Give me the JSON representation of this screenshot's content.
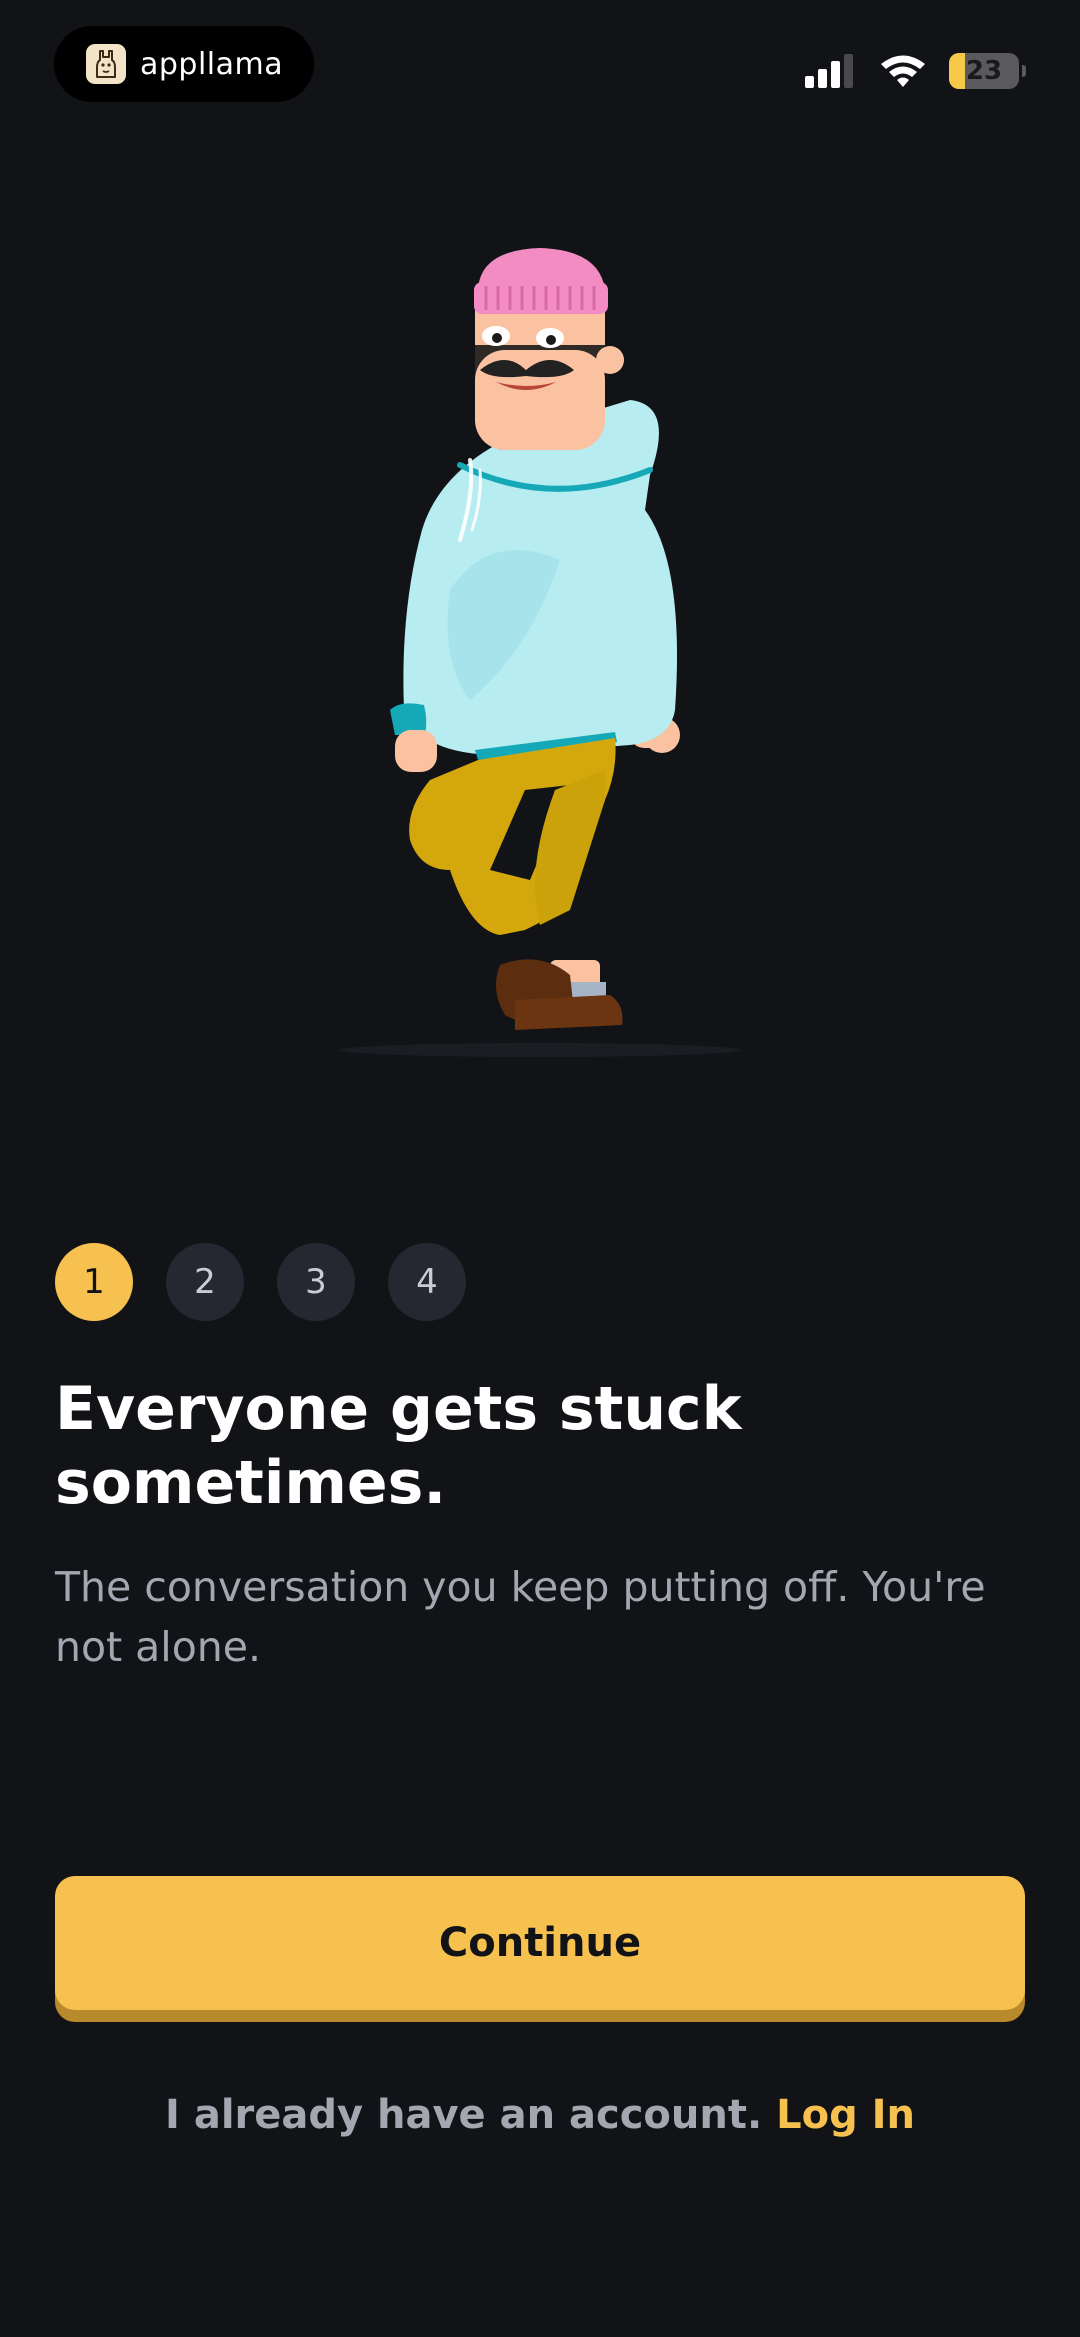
{
  "status_bar": {
    "app_name": "appllama",
    "battery_level": "23",
    "battery_fraction": 0.23,
    "icons": [
      "llama-logo-icon",
      "signal-icon",
      "wifi-icon",
      "battery-icon"
    ]
  },
  "onboarding": {
    "steps": [
      {
        "label": "1",
        "active": true
      },
      {
        "label": "2",
        "active": false
      },
      {
        "label": "3",
        "active": false
      },
      {
        "label": "4",
        "active": false
      }
    ],
    "headline": "Everyone gets stuck sometimes.",
    "subtext": "The conversation you keep putting off. You're not alone.",
    "continue_label": "Continue",
    "login_prompt": "I already have an account.",
    "login_link": "Log In"
  },
  "colors": {
    "background": "#121317",
    "accent": "#f7c14f",
    "accent_shadow": "#b98a2b",
    "step_inactive": "#252830",
    "muted_text": "#a3a7b0"
  }
}
